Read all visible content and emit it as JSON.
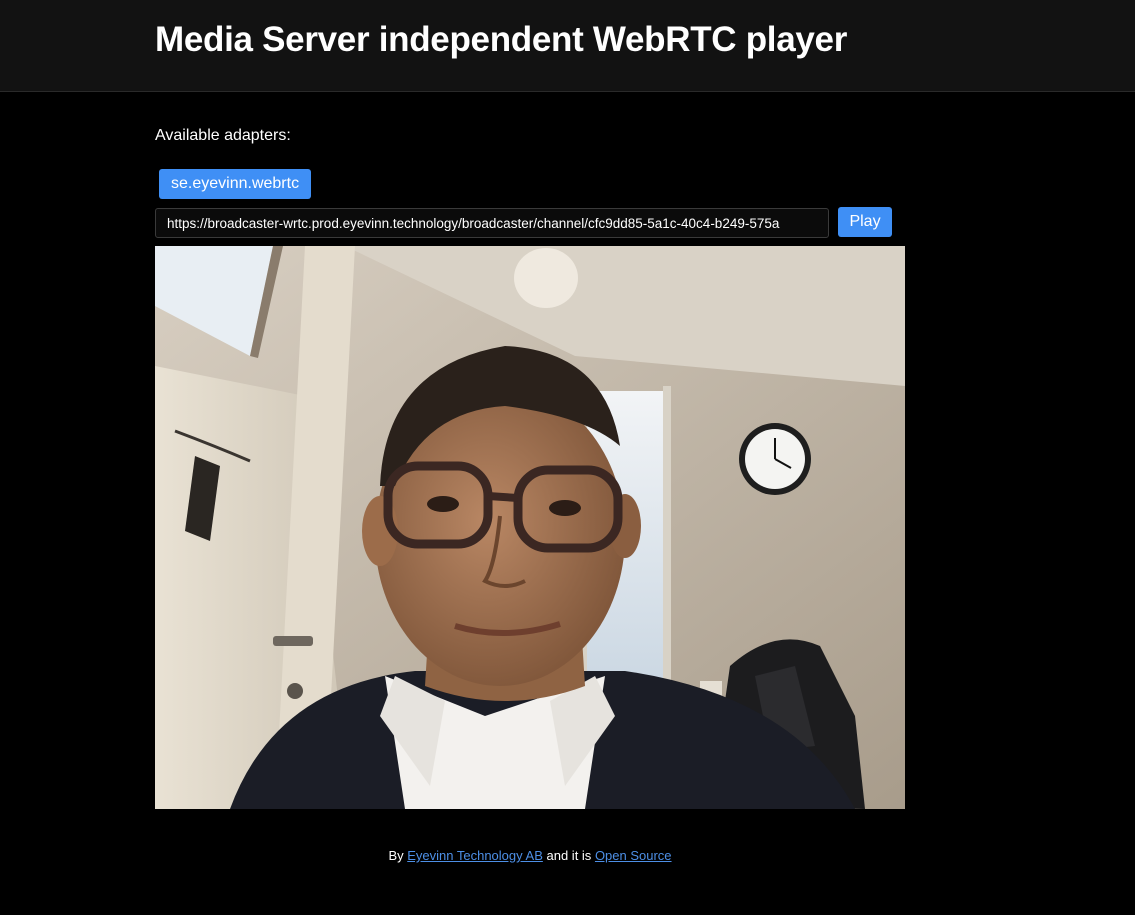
{
  "header": {
    "title": "Media Server independent WebRTC player"
  },
  "adapters": {
    "label": "Available adapters:",
    "items": [
      "se.eyevinn.webrtc"
    ]
  },
  "player": {
    "url_value": "https://broadcaster-wrtc.prod.eyevinn.technology/broadcaster/channel/cfc9dd85-5a1c-40c4-b249-575a",
    "play_label": "Play"
  },
  "footer": {
    "prefix": "By",
    "company_link": "Eyevinn Technology AB",
    "middle": "and it is",
    "source_link": "Open Source"
  },
  "colors": {
    "accent": "#3f8ff5",
    "header_bg": "#121212",
    "page_bg": "#000000",
    "link": "#4d8fe6"
  }
}
